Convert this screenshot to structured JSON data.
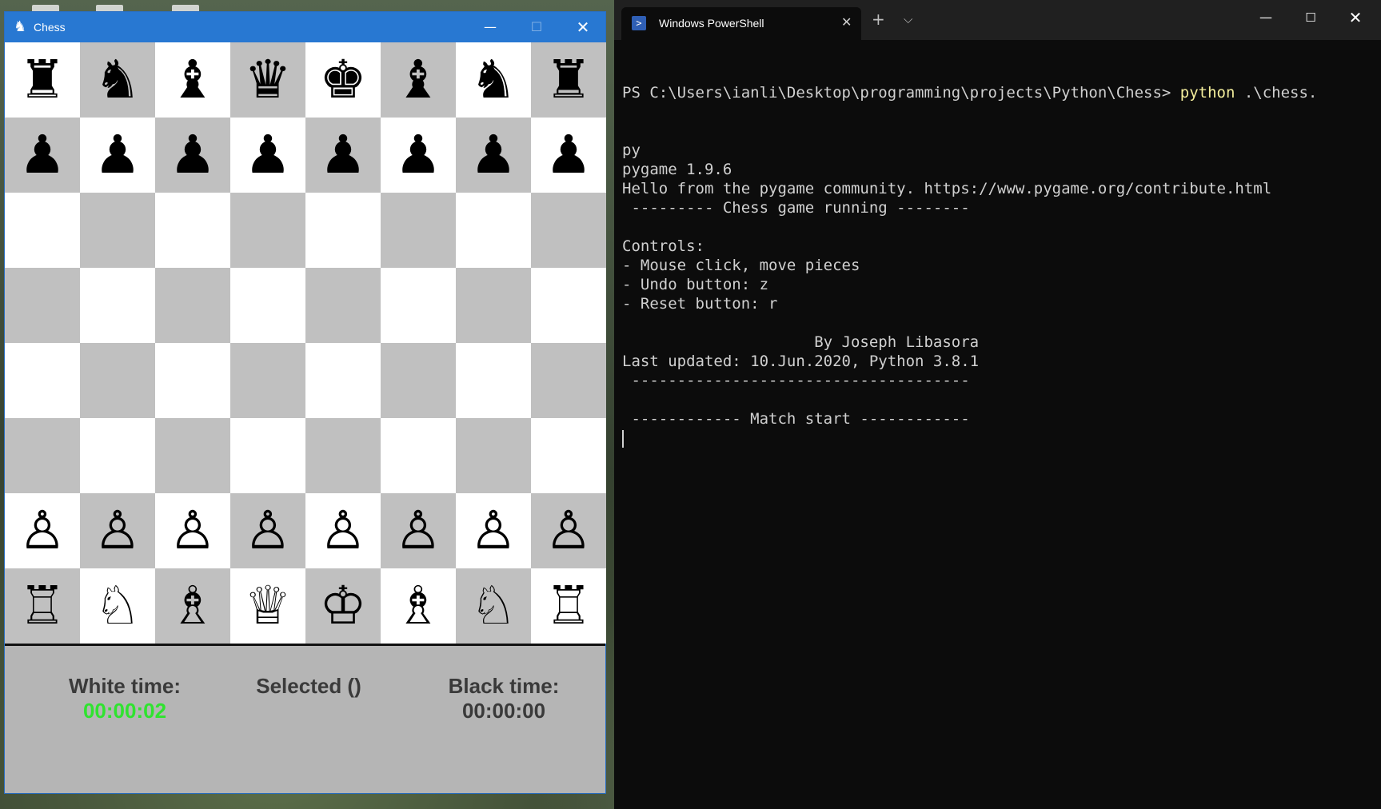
{
  "chess_window": {
    "title": "Chess",
    "controls": {
      "minimize": "—",
      "maximize": "☐",
      "close": "✕"
    },
    "board": [
      [
        "♜",
        "♞",
        "♝",
        "♛",
        "♚",
        "♝",
        "♞",
        "♜"
      ],
      [
        "♟",
        "♟",
        "♟",
        "♟",
        "♟",
        "♟",
        "♟",
        "♟"
      ],
      [
        "",
        "",
        "",
        "",
        "",
        "",
        "",
        ""
      ],
      [
        "",
        "",
        "",
        "",
        "",
        "",
        "",
        ""
      ],
      [
        "",
        "",
        "",
        "",
        "",
        "",
        "",
        ""
      ],
      [
        "",
        "",
        "",
        "",
        "",
        "",
        "",
        ""
      ],
      [
        "♙",
        "♙",
        "♙",
        "♙",
        "♙",
        "♙",
        "♙",
        "♙"
      ],
      [
        "♖",
        "♘",
        "♗",
        "♕",
        "♔",
        "♗",
        "♘",
        "♖"
      ]
    ],
    "info": {
      "white_time_label": "White time:",
      "white_time_value": "00:00:02",
      "selected_label": "Selected ()",
      "black_time_label": "Black time:",
      "black_time_value": "00:00:00"
    }
  },
  "terminal_window": {
    "tab_title": "Windows PowerShell",
    "new_tab": "+",
    "dropdown": "⌵",
    "controls": {
      "minimize": "—",
      "maximize": "☐",
      "close": "✕"
    },
    "prompt": "PS C:\\Users\\ianli\\Desktop\\programming\\projects\\Python\\Chess> ",
    "command": "python",
    "command_args": " .\\chess.",
    "lines": [
      "py",
      "pygame 1.9.6",
      "Hello from the pygame community. https://www.pygame.org/contribute.html",
      " --------- Chess game running --------",
      "",
      "Controls:",
      "- Mouse click, move pieces",
      "- Undo button: z",
      "- Reset button: r",
      "",
      "                     By Joseph Libasora",
      "Last updated: 10.Jun.2020, Python 3.8.1",
      " -------------------------------------",
      "",
      " ------------ Match start ------------"
    ]
  },
  "colors": {
    "light_square": "#ffffff",
    "dark_square": "#c0c0c0",
    "white_time": "#2fe32f",
    "titlebar": "#2878d2",
    "terminal_bg": "#0c0c0c",
    "command_highlight": "#f4ee9c"
  }
}
